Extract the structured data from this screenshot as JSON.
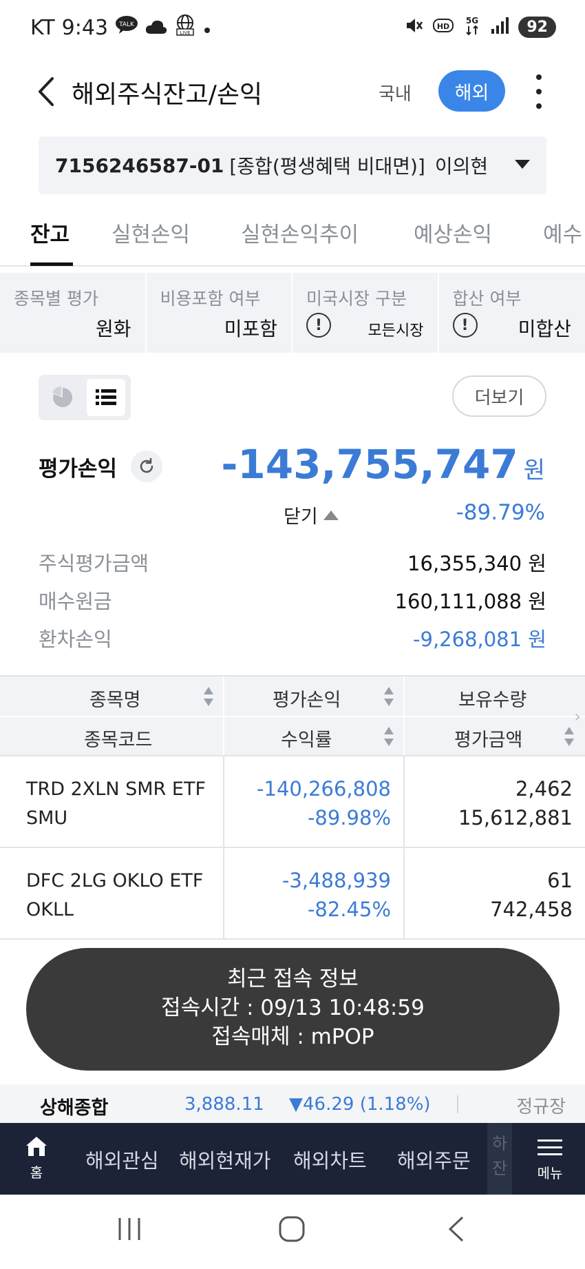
{
  "status_bar": {
    "carrier": "KT",
    "time": "9:43",
    "talk_icon_text": "TALK",
    "live_icon_text": "LIVE",
    "hd_text": "HD",
    "network": "5G",
    "battery": "92"
  },
  "header": {
    "title": "해외주식잔고/손익",
    "domestic_label": "국내",
    "overseas_label": "해외"
  },
  "account": {
    "number": "7156246587-01",
    "type": "[종합(평생혜택 비대면)]",
    "owner": "이의현"
  },
  "tabs": [
    {
      "label": "잔고",
      "active": true
    },
    {
      "label": "실현손익",
      "active": false
    },
    {
      "label": "실현손익추이",
      "active": false
    },
    {
      "label": "예상손익",
      "active": false
    },
    {
      "label": "예수",
      "active": false
    }
  ],
  "filters": [
    {
      "label": "종목별 평가",
      "value": "원화"
    },
    {
      "label": "비용포함 여부",
      "value": "미포함"
    },
    {
      "label": "미국시장 구분",
      "value": "모든시장"
    },
    {
      "label": "합산 여부",
      "value": "미합산"
    }
  ],
  "more_label": "더보기",
  "summary": {
    "pl_label": "평가손익",
    "pl_value": "-143,755,747",
    "pl_unit": "원",
    "close_label": "닫기",
    "pl_rate": "-89.79%",
    "rows": [
      {
        "label": "주식평가금액",
        "value": "16,355,340 원",
        "negative": false
      },
      {
        "label": "매수원금",
        "value": "160,111,088 원",
        "negative": false
      },
      {
        "label": "환차손익",
        "value": "-9,268,081 원",
        "negative": true
      }
    ]
  },
  "table": {
    "headers": {
      "col1_top": "종목명",
      "col1_bottom": "종목코드",
      "col2_top": "평가손익",
      "col2_bottom": "수익률",
      "col3_top": "보유수량",
      "col3_bottom": "평가금액"
    },
    "rows": [
      {
        "name": "TRD 2XLN SMR ETF",
        "code": "SMU",
        "pl": "-140,266,808",
        "rate": "-89.98%",
        "qty": "2,462",
        "eval": "15,612,881"
      },
      {
        "name": "DFC 2LG OKLO ETF",
        "code": "OKLL",
        "pl": "-3,488,939",
        "rate": "-82.45%",
        "qty": "61",
        "eval": "742,458"
      }
    ]
  },
  "toast": {
    "title": "최근 접속 정보",
    "time_line": "접속시간 : 09/13 10:48:59",
    "media_line": "접속매체 : mPOP"
  },
  "ticker": {
    "name": "상해종합",
    "price": "3,888.11",
    "change": "▼46.29 (1.18%)",
    "session": "정규장"
  },
  "bottom_nav": {
    "home": "홈",
    "items": [
      "해외관심",
      "해외현재가",
      "해외차트",
      "해외주문"
    ],
    "faded": "하\n잔",
    "menu": "메뉴"
  },
  "colors": {
    "accent": "#3a86e8",
    "negative": "#3b7bd6",
    "nav_bg": "#1c2336",
    "toast_bg": "#3a3a3a"
  }
}
